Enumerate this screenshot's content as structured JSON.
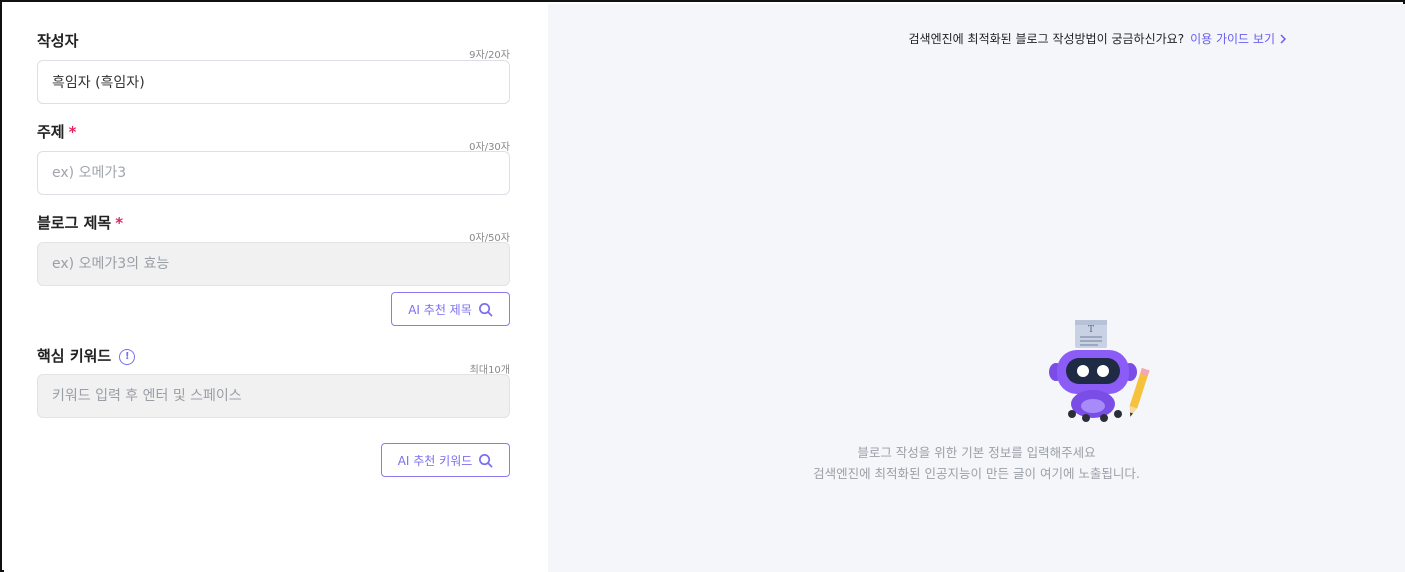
{
  "form": {
    "author": {
      "label": "작성자",
      "counter": "9자/20자",
      "value": "흑임자 (흑임자)"
    },
    "topic": {
      "label": "주제",
      "required_mark": "*",
      "counter": "0자/30자",
      "placeholder": "ex) 오메가3"
    },
    "blog_title": {
      "label": "블로그 제목",
      "required_mark": "*",
      "counter": "0자/50자",
      "placeholder": "ex) 오메가3의 효능"
    },
    "ai_title_button": "AI 추천 제목",
    "keywords": {
      "label": "핵심 키워드",
      "info_icon": "!",
      "counter": "최대10개",
      "placeholder": "키워드 입력 후 엔터 및 스페이스"
    },
    "ai_keyword_button": "AI 추천 키워드"
  },
  "preview": {
    "guide_text": "검색엔진에 최적화된 블로그 작성방법이 궁금하신가요?",
    "guide_link": "이용 가이드 보기",
    "empty_line1": "블로그 작성을 위한 기본 정보를 입력해주세요",
    "empty_line2": "검색엔진에 최적화된 인공지능이 만든 글이 여기에 노출됩니다.",
    "robot_icon": "robot-writer-icon"
  },
  "colors": {
    "accent": "#7b6ef0",
    "required": "#e0245e",
    "preview_bg": "#f4f6f9"
  }
}
